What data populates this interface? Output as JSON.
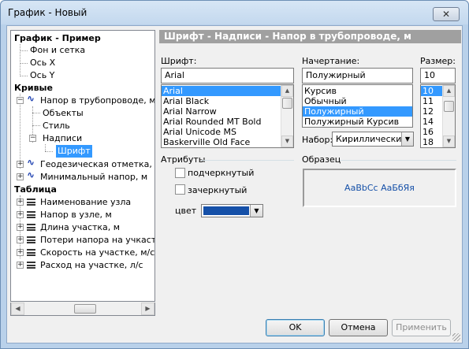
{
  "window": {
    "title": "График - Новый",
    "close_label": "✕"
  },
  "tree": {
    "root": "График - Пример",
    "root_children": [
      "Фон и сетка",
      "Ось X",
      "Ось Y"
    ],
    "curves_label": "Кривые",
    "curve1": "Напор в трубопроводе, м",
    "curve1_children": [
      "Объекты",
      "Стиль"
    ],
    "labels_node": "Надписи",
    "font_node": "Шрифт",
    "curve2": "Геодезическая отметка, м",
    "curve3": "Минимальный напор, м",
    "table_label": "Таблица",
    "table_items": [
      "Наименование узла",
      "Напор в узле, м",
      "Длина участка, м",
      "Потери напора на учкастке",
      "Скорость на участке, м/с",
      "Расход на участке, л/с"
    ]
  },
  "panel": {
    "header": "Шрифт - Надписи - Напор в трубопроводе, м",
    "font_label": "Шрифт:",
    "font_value": "Arial",
    "font_list": [
      "Arial",
      "Arial Black",
      "Arial Narrow",
      "Arial Rounded MT Bold",
      "Arial Unicode MS",
      "Baskerville Old Face"
    ],
    "style_label": "Начертание:",
    "style_value": "Полужирный",
    "style_list": [
      "Курсив",
      "Обычный",
      "Полужирный",
      "Полужирный Курсив"
    ],
    "size_label": "Размер:",
    "size_value": "10",
    "size_list": [
      "10",
      "11",
      "12",
      "14",
      "16",
      "18"
    ],
    "charset_label": "Набор:",
    "charset_value": "Кириллический",
    "attributes_label": "Атрибуты",
    "underline_label": "подчеркнутый",
    "strike_label": "зачеркнутый",
    "color_label": "цвет",
    "color_value": "#1550a8",
    "sample_label": "Образец",
    "sample_text": "AaBbCc AaБбЯя",
    "sample_color": "#1550a8"
  },
  "buttons": {
    "ok": "OK",
    "cancel": "Отмена",
    "apply": "Применить"
  }
}
